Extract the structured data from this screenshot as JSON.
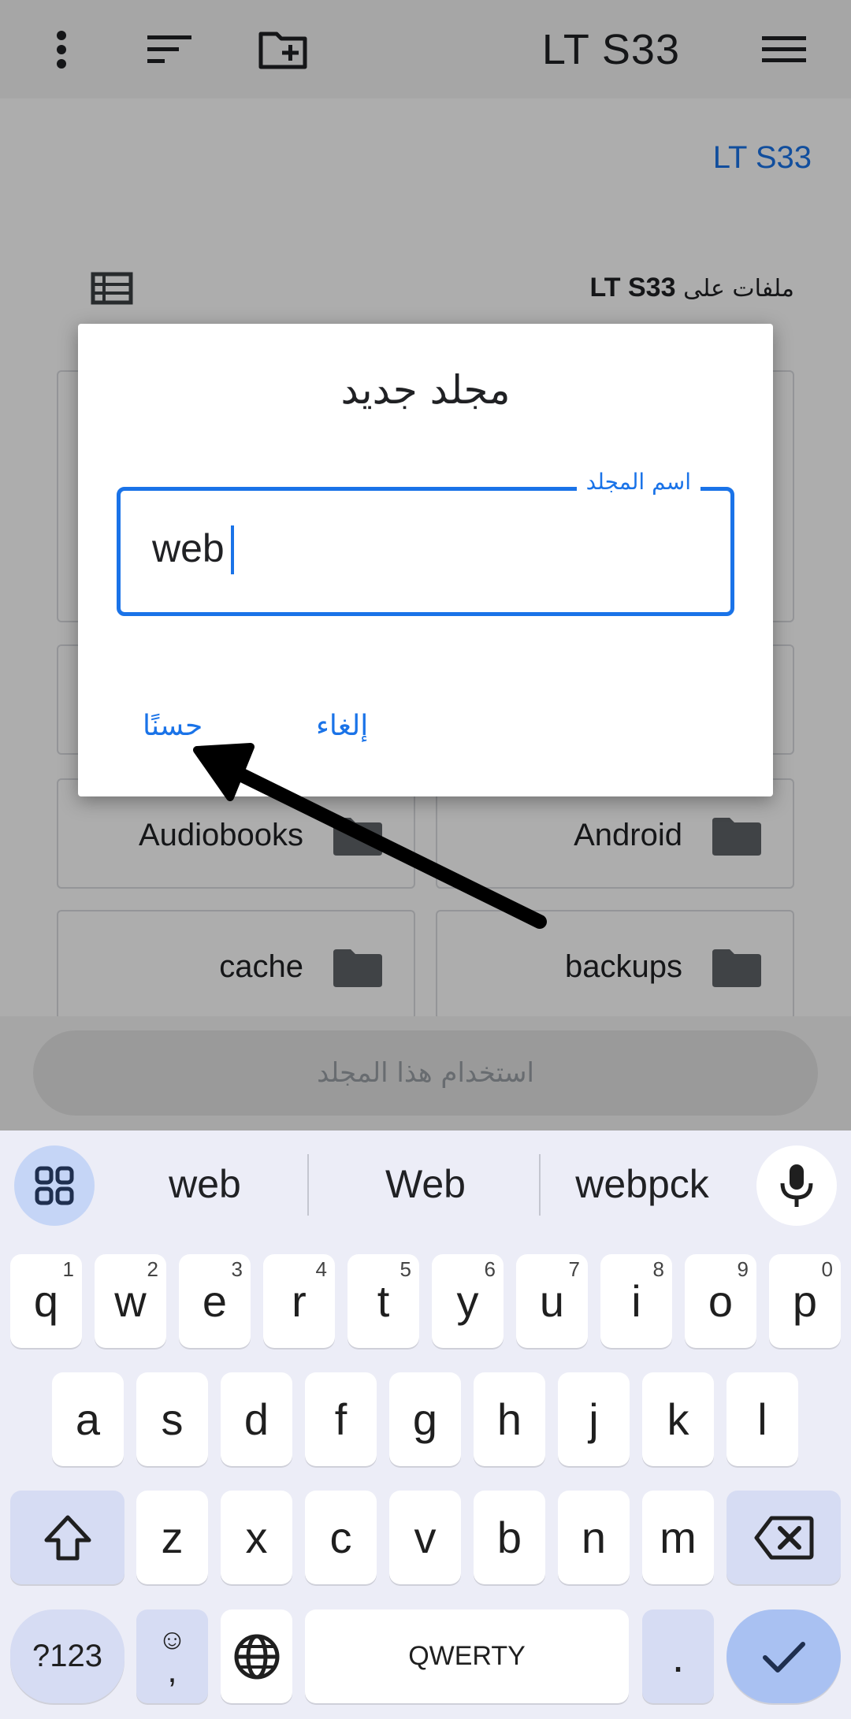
{
  "toolbar": {
    "title": "LT S33",
    "icons": [
      "more-vert-icon",
      "sort-icon",
      "new-folder-icon",
      "hamburger-menu-icon"
    ]
  },
  "breadcrumb": {
    "label": "LT S33"
  },
  "files_header": {
    "prefix": "ملفات على",
    "device": "LT S33"
  },
  "folders": [
    {
      "label": "Android"
    },
    {
      "label": "Audiobooks"
    },
    {
      "label": "backups"
    },
    {
      "label": "cache"
    }
  ],
  "use_folder_button": "استخدام هذا المجلد",
  "dialog": {
    "title": "مجلد جديد",
    "field_label": "اسم المجلد",
    "field_value": "web",
    "cancel_label": "إلغاء",
    "ok_label": "حسنًا"
  },
  "keyboard": {
    "suggestions": [
      "web",
      "Web",
      "webpck"
    ],
    "row1": [
      {
        "k": "q",
        "h": "1"
      },
      {
        "k": "w",
        "h": "2"
      },
      {
        "k": "e",
        "h": "3"
      },
      {
        "k": "r",
        "h": "4"
      },
      {
        "k": "t",
        "h": "5"
      },
      {
        "k": "y",
        "h": "6"
      },
      {
        "k": "u",
        "h": "7"
      },
      {
        "k": "i",
        "h": "8"
      },
      {
        "k": "o",
        "h": "9"
      },
      {
        "k": "p",
        "h": "0"
      }
    ],
    "row2": [
      "a",
      "s",
      "d",
      "f",
      "g",
      "h",
      "j",
      "k",
      "l"
    ],
    "row3": [
      "z",
      "x",
      "c",
      "v",
      "b",
      "n",
      "m"
    ],
    "symbols_label": "?123",
    "emoji_comma_top": "☺",
    "emoji_comma_bottom": ",",
    "space_label": "QWERTY",
    "period_label": "."
  },
  "colors": {
    "accent": "#1a73e8",
    "folder_icon": "#5f6368",
    "keyboard_bg": "#ecedf7",
    "modifier_key": "#d6dcf3",
    "enter_key": "#a9c1f2"
  }
}
